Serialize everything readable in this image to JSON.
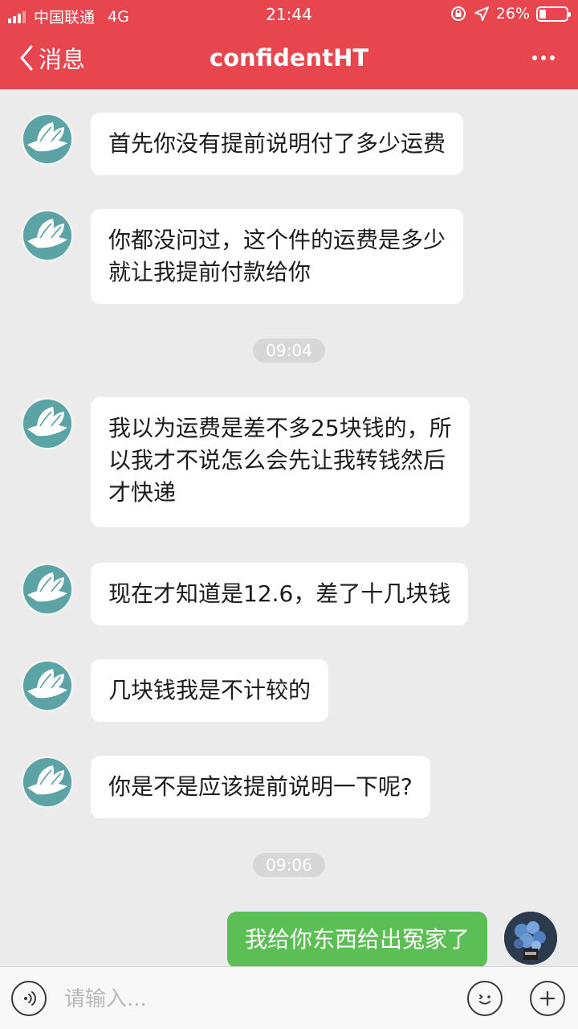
{
  "status_bar": {
    "carrier": "中国联通",
    "network": "4G",
    "time": "21:44",
    "battery_percent": "26%",
    "battery_level": 0.26
  },
  "nav": {
    "back_label": "消息",
    "title": "confidentHT"
  },
  "messages": [
    {
      "from": "other",
      "lines": [
        "首先你没有提前说明付了多少运费"
      ]
    },
    {
      "from": "other",
      "lines": [
        "你都没问过，这个件的运费是多少",
        "就让我提前付款给你"
      ]
    },
    {
      "from": "time",
      "text": "09:04"
    },
    {
      "from": "other",
      "lines": [
        "我以为运费是差不多25块钱的，所",
        "以我才不说怎么会先让我转钱然后",
        "才快递"
      ]
    },
    {
      "from": "other",
      "lines": [
        "现在才知道是12.6，差了十几块钱"
      ]
    },
    {
      "from": "other",
      "lines": [
        "几块钱我是不计较的"
      ]
    },
    {
      "from": "other",
      "lines": [
        "你是不是应该提前说明一下呢?"
      ]
    },
    {
      "from": "time",
      "text": "09:06"
    },
    {
      "from": "me",
      "lines": [
        "我给你东西给出冤家了"
      ]
    }
  ],
  "input_bar": {
    "placeholder": "请输入..."
  },
  "colors": {
    "header": "#e8464f",
    "my_bubble": "#5cbf55",
    "other_bubble": "#ffffff",
    "background": "#ebebeb"
  }
}
